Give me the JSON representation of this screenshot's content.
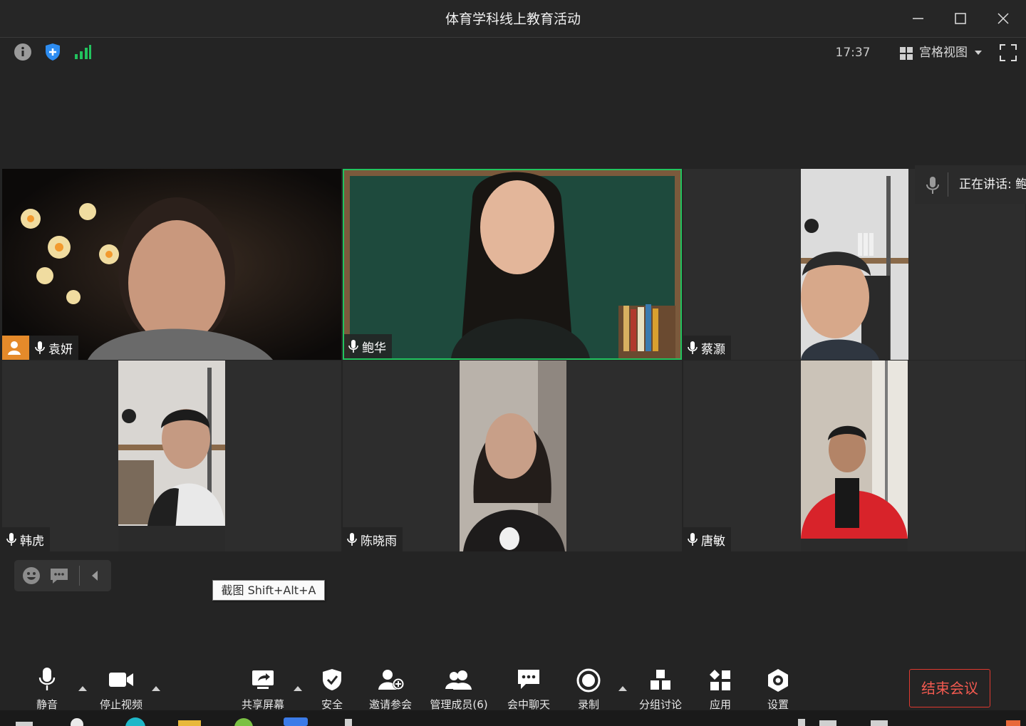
{
  "window": {
    "title": "体育学科线上教育活动"
  },
  "topbar": {
    "time": "17:37",
    "view_mode_label": "宫格视图"
  },
  "speaking": {
    "text": "正在讲话: 鲍华"
  },
  "participants": [
    {
      "name": "袁妍",
      "has_avatar_badge": true
    },
    {
      "name": "鲍华",
      "active_speaker": true
    },
    {
      "name": "蔡灏"
    },
    {
      "name": "韩虎"
    },
    {
      "name": "陈晓雨"
    },
    {
      "name": "唐敏"
    }
  ],
  "tooltip": {
    "text": "截图 Shift+Alt+A"
  },
  "toolbar": {
    "mute": "静音",
    "stop_video": "停止视频",
    "share_screen": "共享屏幕",
    "security": "安全",
    "invite": "邀请参会",
    "manage_participants": "管理成员(6)",
    "chat": "会中聊天",
    "record": "录制",
    "breakout": "分组讨论",
    "apps": "应用",
    "settings": "设置",
    "end_meeting": "结束会议"
  },
  "colors": {
    "accent_green": "#22c35e",
    "end_red": "#e0392f",
    "shield_blue": "#2d8cf0",
    "badge_orange": "#e58a2a"
  }
}
